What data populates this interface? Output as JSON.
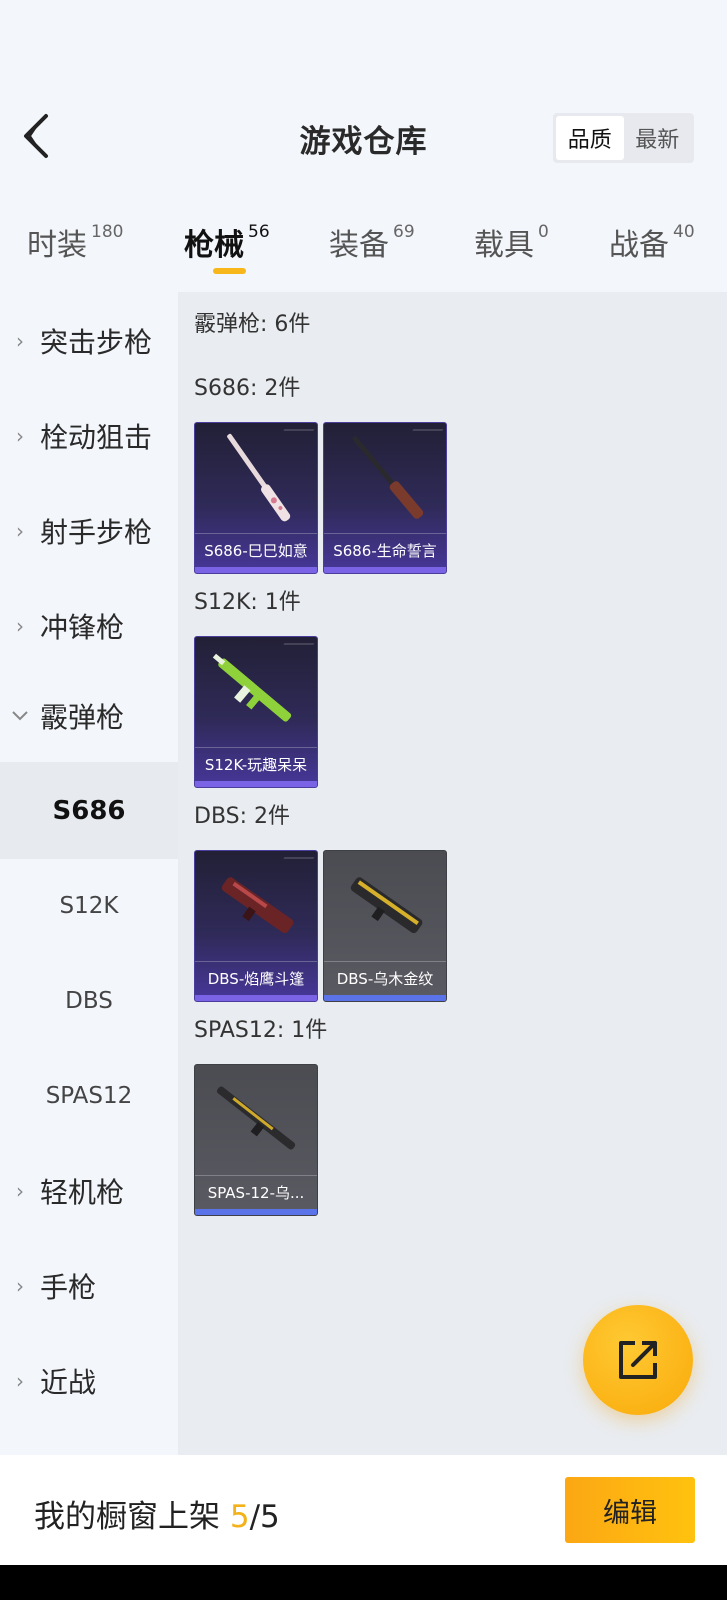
{
  "header": {
    "title": "游戏仓库",
    "sort_options": [
      "品质",
      "最新"
    ],
    "sort_active": "品质"
  },
  "tabs": [
    {
      "label": "时装",
      "count": "180"
    },
    {
      "label": "枪械",
      "count": "56"
    },
    {
      "label": "装备",
      "count": "69"
    },
    {
      "label": "载具",
      "count": "0"
    },
    {
      "label": "战备",
      "count": "40"
    }
  ],
  "sidebar": {
    "categories": [
      "突击步枪",
      "栓动狙击",
      "射手步枪",
      "冲锋枪",
      "霰弹枪",
      "轻机枪",
      "手枪",
      "近战"
    ],
    "subitems": [
      "S686",
      "S12K",
      "DBS",
      "SPAS12"
    ],
    "active_subitem": "S686"
  },
  "content": {
    "category_summary": "霰弹枪: 6件",
    "groups": [
      {
        "title": "S686: 2件",
        "items": [
          {
            "name": "S686-巳巳如意",
            "quality": "purple"
          },
          {
            "name": "S686-生命誓言",
            "quality": "purple"
          }
        ]
      },
      {
        "title": "S12K: 1件",
        "items": [
          {
            "name": "S12K-玩趣呆呆",
            "quality": "purple"
          }
        ]
      },
      {
        "title": "DBS: 2件",
        "items": [
          {
            "name": "DBS-焰鹰斗篷",
            "quality": "purple"
          },
          {
            "name": "DBS-乌木金纹",
            "quality": "gray"
          }
        ]
      },
      {
        "title": "SPAS12: 1件",
        "items": [
          {
            "name": "SPAS-12-乌...",
            "quality": "gray"
          }
        ]
      }
    ]
  },
  "bottom": {
    "label": "我的橱窗上架",
    "current": "5",
    "separator": "/",
    "total": "5",
    "edit_label": "编辑"
  },
  "colors": {
    "accent": "#f7b71b",
    "purple_quality": "#7b63e6",
    "gray_quality": "#5a73e8"
  }
}
